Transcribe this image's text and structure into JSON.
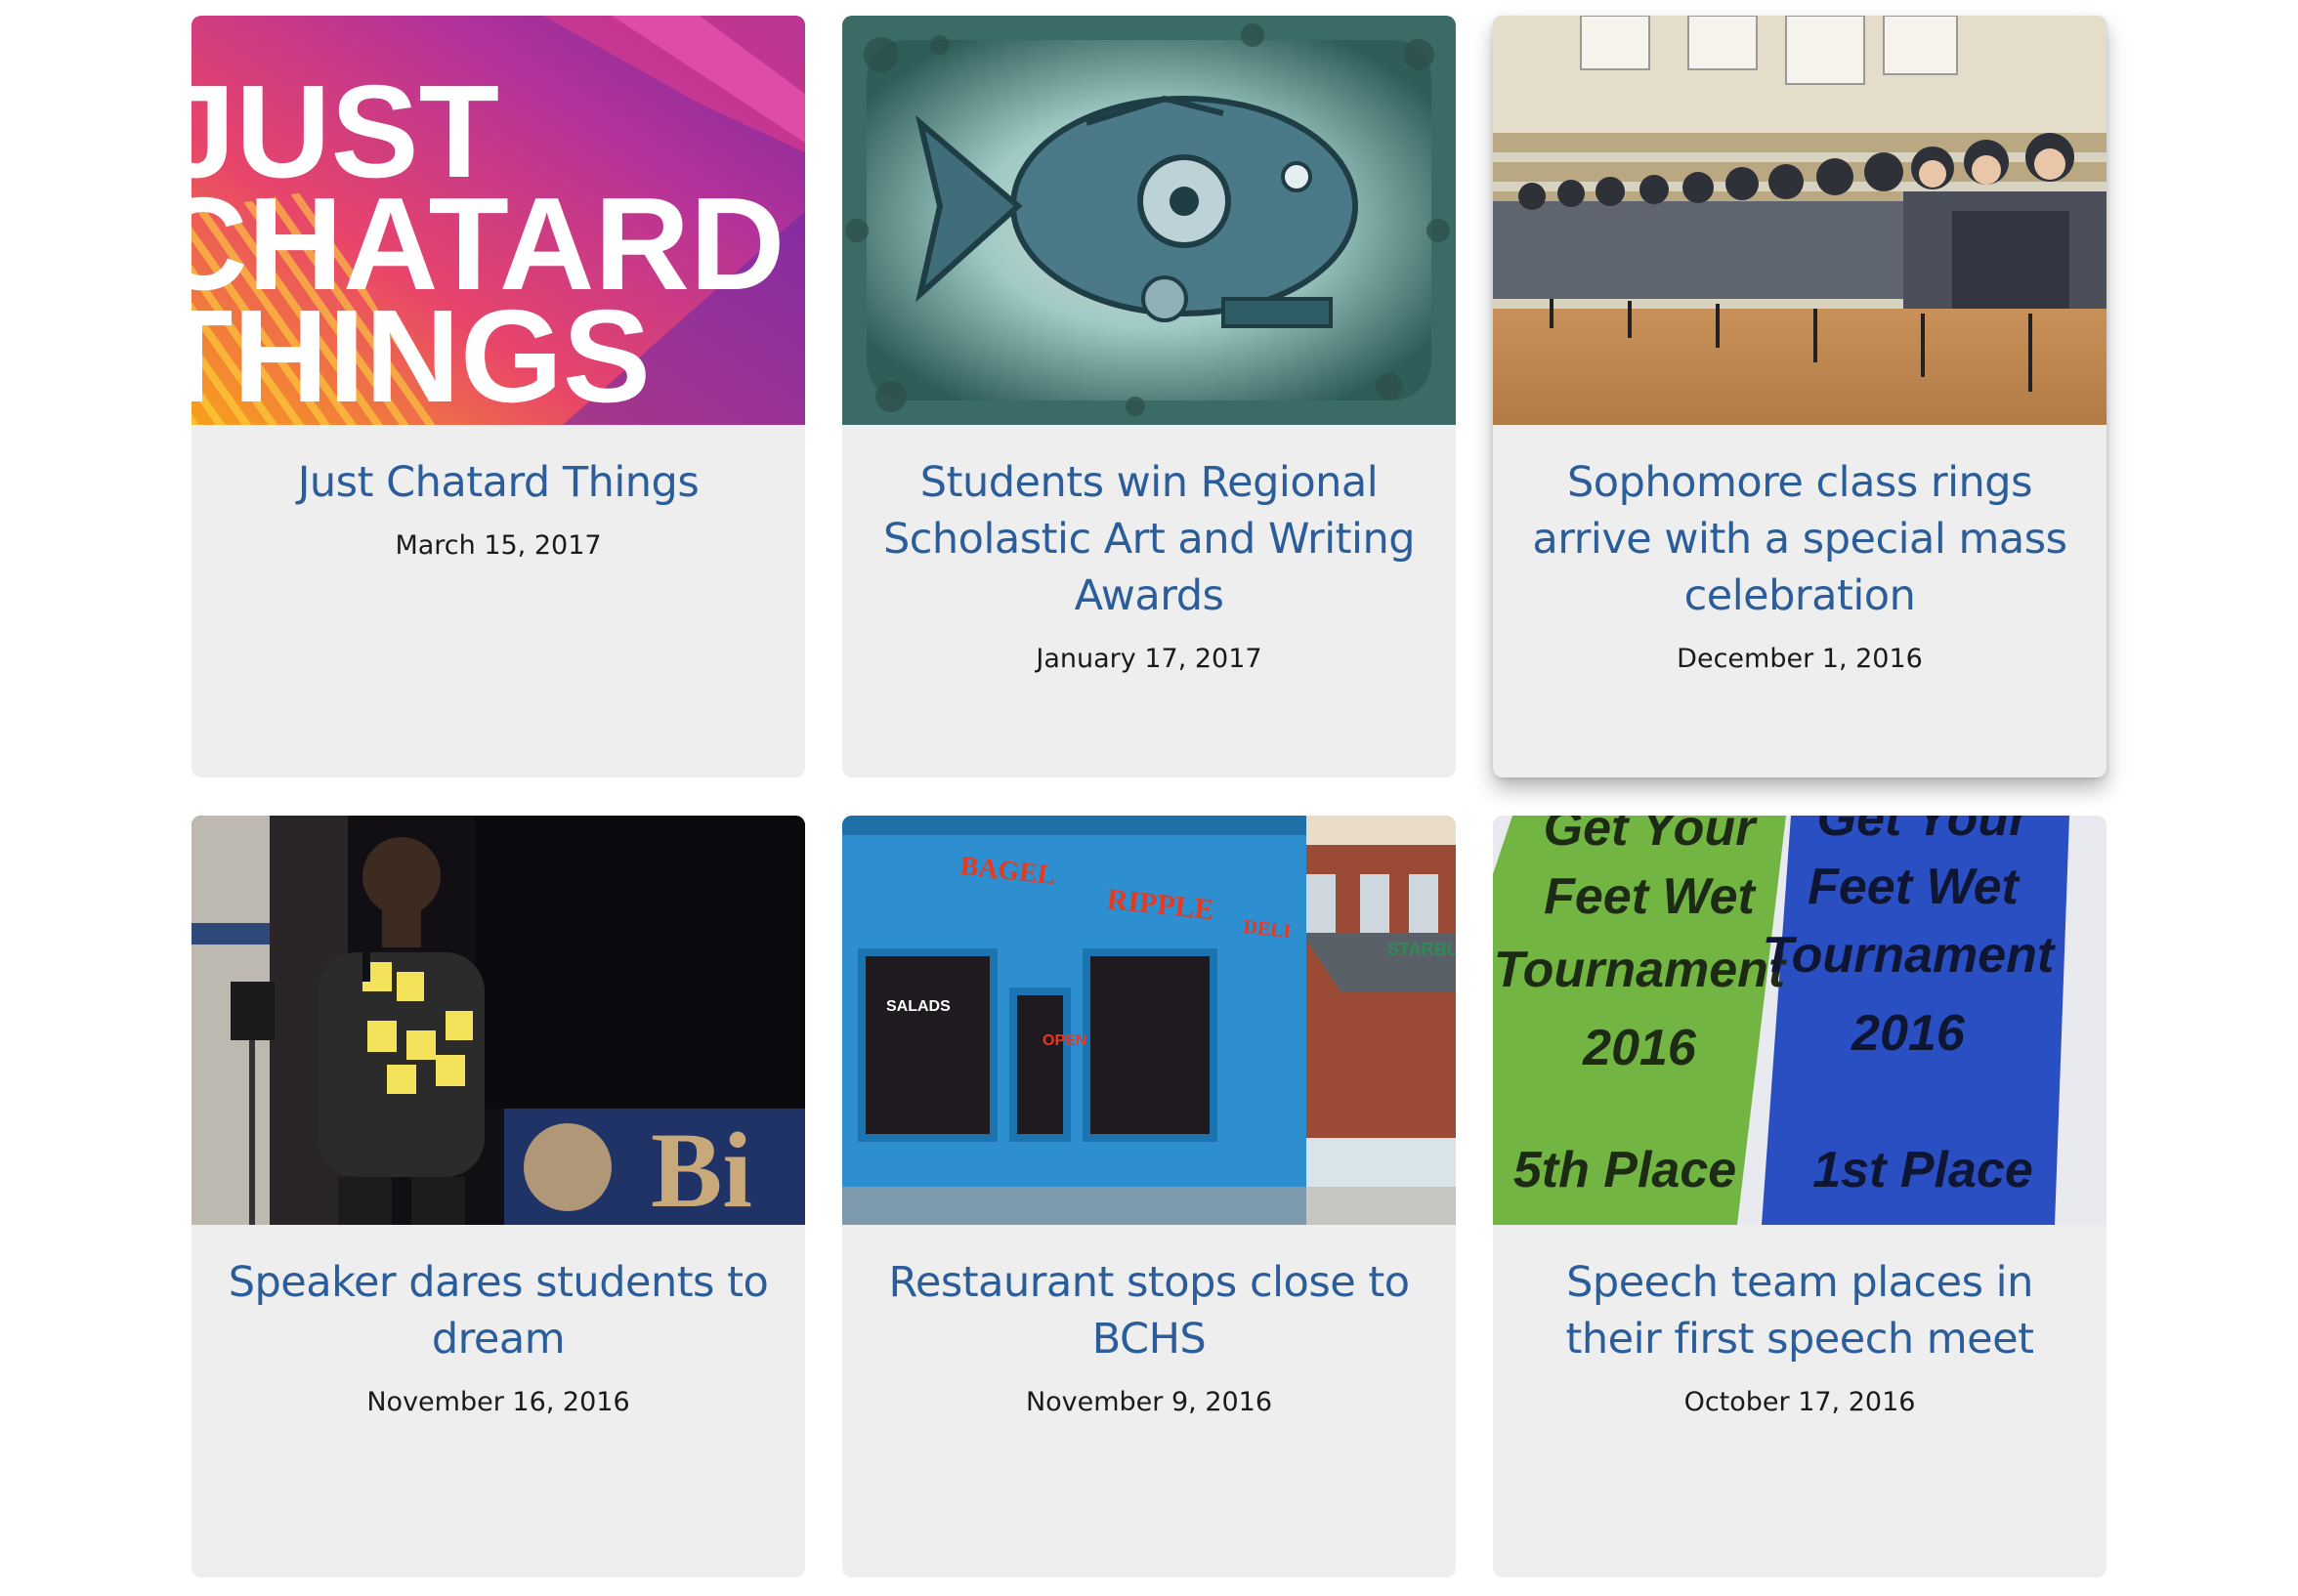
{
  "articles": [
    {
      "title": "Just Chatard Things",
      "date": "March 15, 2017",
      "image": {
        "subject": "colorful title graphic",
        "text_lines": [
          "JUST",
          "CHATARD",
          "THINGS"
        ]
      }
    },
    {
      "title": "Students win Regional Scholastic Art and Writing Awards",
      "date": "January 17, 2017",
      "image": {
        "subject": "mechanical fish artwork"
      }
    },
    {
      "title": "Sophomore class rings arrive with a special mass celebration",
      "date": "December 1, 2016",
      "image": {
        "subject": "students seated in gymnasium"
      }
    },
    {
      "title": "Speaker dares students to dream",
      "date": "November 16, 2016",
      "image": {
        "subject": "speaker with microphone and sticky notes",
        "text_lines": [
          "Bi"
        ]
      }
    },
    {
      "title": "Restaurant stops close to BCHS",
      "date": "November 9, 2016",
      "image": {
        "subject": "blue storefront",
        "text_lines": [
          "BAGEL",
          "RIPPLE",
          "DELI",
          "OPEN",
          "SALADS",
          "STARBUCKS"
        ]
      }
    },
    {
      "title": "Speech team places in their first speech meet",
      "date": "October 17, 2016",
      "image": {
        "subject": "green and blue award ribbons",
        "text_lines": [
          "Get Your",
          "Feet Wet",
          "Tournament",
          "2016",
          "5th Place",
          "1st Place"
        ]
      }
    }
  ]
}
